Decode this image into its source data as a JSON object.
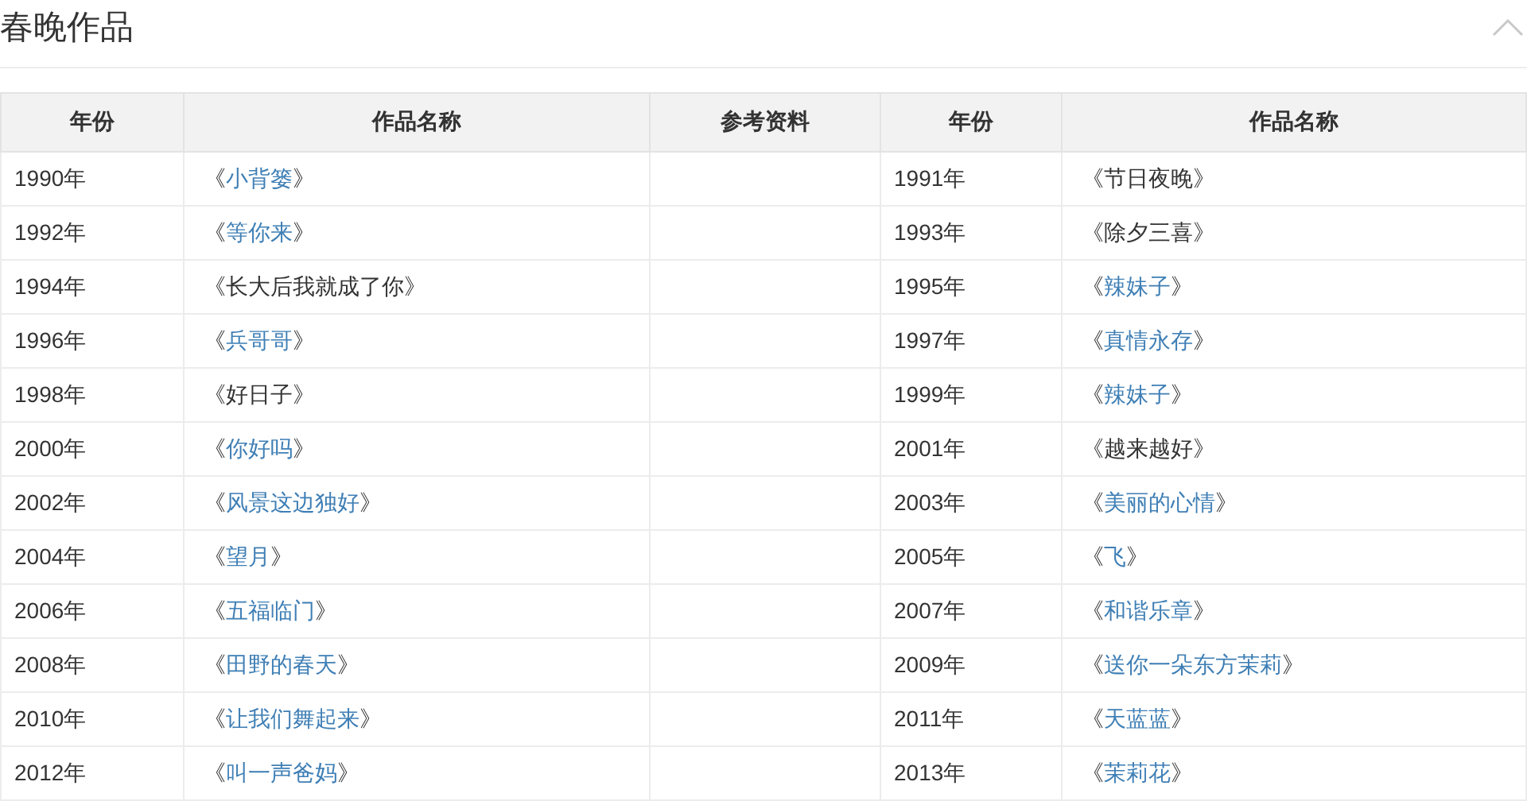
{
  "section": {
    "title": "春晚作品",
    "collapsed": false
  },
  "table": {
    "columns": [
      "年份",
      "作品名称",
      "参考资料",
      "年份",
      "作品名称"
    ],
    "rows": [
      {
        "year_1": "1990年",
        "work_1": {
          "open": "《",
          "name": "小背篓",
          "close": "》",
          "linked": true
        },
        "year_2": "1991年",
        "work_2": {
          "open": "《",
          "name": "节日夜晚",
          "close": "》",
          "linked": false
        }
      },
      {
        "year_1": "1992年",
        "work_1": {
          "open": "《",
          "name": "等你来",
          "close": "》",
          "linked": true
        },
        "year_2": "1993年",
        "work_2": {
          "open": "《",
          "name": "除夕三喜",
          "close": "》",
          "linked": false
        }
      },
      {
        "year_1": "1994年",
        "work_1": {
          "open": "《",
          "name": "长大后我就成了你",
          "close": "》",
          "linked": false
        },
        "year_2": "1995年",
        "work_2": {
          "open": "《",
          "name": "辣妹子",
          "close": "》",
          "linked": true
        }
      },
      {
        "year_1": "1996年",
        "work_1": {
          "open": "《",
          "name": "兵哥哥",
          "close": "》",
          "linked": true
        },
        "year_2": "1997年",
        "work_2": {
          "open": "《",
          "name": "真情永存",
          "close": "》",
          "linked": true
        }
      },
      {
        "year_1": "1998年",
        "work_1": {
          "open": "《",
          "name": "好日子",
          "close": "》",
          "linked": false
        },
        "year_2": "1999年",
        "work_2": {
          "open": "《",
          "name": "辣妹子",
          "close": "》",
          "linked": true
        }
      },
      {
        "year_1": "2000年",
        "work_1": {
          "open": "《",
          "name": "你好吗",
          "close": "》",
          "linked": true
        },
        "year_2": "2001年",
        "work_2": {
          "open": "《",
          "name": "越来越好",
          "close": "》",
          "linked": false
        }
      },
      {
        "year_1": "2002年",
        "work_1": {
          "open": "《",
          "name": "风景这边独好",
          "close": "》",
          "linked": true
        },
        "year_2": "2003年",
        "work_2": {
          "open": "《",
          "name": "美丽的心情",
          "close": "》",
          "linked": true
        }
      },
      {
        "year_1": "2004年",
        "work_1": {
          "open": "《",
          "name": "望月",
          "close": "》",
          "linked": true
        },
        "year_2": "2005年",
        "work_2": {
          "open": "《",
          "name": "飞",
          "close": "》",
          "linked": true
        }
      },
      {
        "year_1": "2006年",
        "work_1": {
          "open": "《",
          "name": "五福临门",
          "close": "》",
          "linked": true
        },
        "year_2": "2007年",
        "work_2": {
          "open": "《",
          "name": "和谐乐章",
          "close": "》",
          "linked": true
        }
      },
      {
        "year_1": "2008年",
        "work_1": {
          "open": "《",
          "name": "田野的春天",
          "close": "》",
          "linked": true
        },
        "year_2": "2009年",
        "work_2": {
          "open": "《",
          "name": "送你一朵东方茉莉",
          "close": "》",
          "linked": true
        }
      },
      {
        "year_1": "2010年",
        "work_1": {
          "open": "《",
          "name": "让我们舞起来",
          "close": "》",
          "linked": true
        },
        "year_2": "2011年",
        "work_2": {
          "open": "《",
          "name": "天蓝蓝",
          "close": "》",
          "linked": true
        }
      },
      {
        "year_1": "2012年",
        "work_1": {
          "open": "《",
          "name": "叫一声爸妈",
          "close": "》",
          "linked": true
        },
        "year_2": "2013年",
        "work_2": {
          "open": "《",
          "name": "茉莉花",
          "close": "》",
          "linked": true
        }
      }
    ]
  }
}
